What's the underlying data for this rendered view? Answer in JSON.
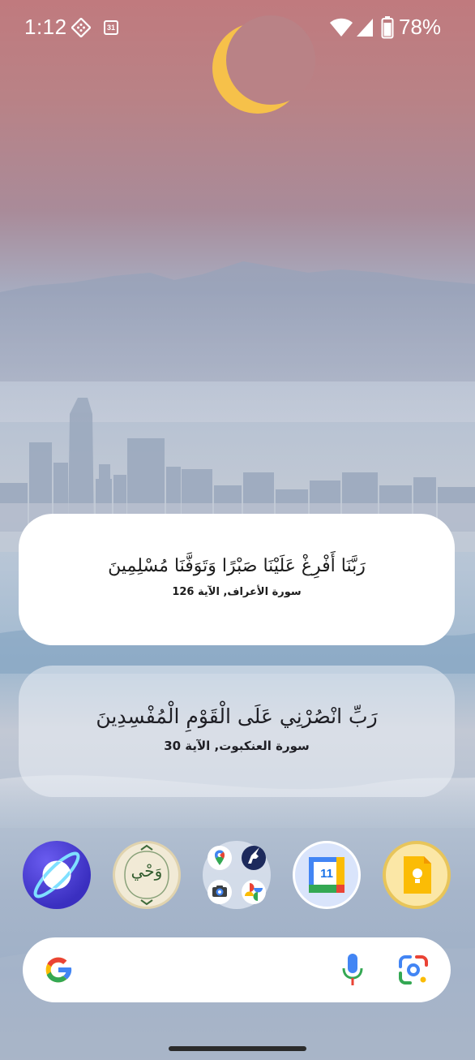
{
  "status_bar": {
    "time": "1:12",
    "calendar_badge": "31",
    "battery_percent": "78%",
    "icons": [
      "dnd-sync-icon",
      "calendar-icon",
      "wifi-icon",
      "signal-icon",
      "battery-icon"
    ]
  },
  "widgets": [
    {
      "verse": "رَبَّنَا أَفْرِغْ عَلَيْنَا صَبْرًا وَتَوَفَّنَا مُسْلِمِينَ",
      "reference": "سورة الأعراف, الآية 126"
    },
    {
      "verse": "رَبِّ انْصُرْنِي عَلَى الْقَوْمِ الْمُفْسِدِينَ",
      "reference": "سورة العنكبوت, الآية 30"
    }
  ],
  "dock": {
    "apps": [
      "browser-app",
      "wahy-app",
      "google-folder",
      "calendar-app",
      "keep-notes-app"
    ],
    "wahy_label": "وَحْي",
    "calendar_day": "11"
  },
  "search_bar": {
    "icons": [
      "google-logo-icon",
      "microphone-icon",
      "google-lens-icon"
    ]
  },
  "colors": {
    "widget_primary_bg": "#ffffff",
    "google_blue": "#4285F4",
    "google_red": "#EA4335",
    "google_yellow": "#FBBC05",
    "google_green": "#34A853"
  }
}
